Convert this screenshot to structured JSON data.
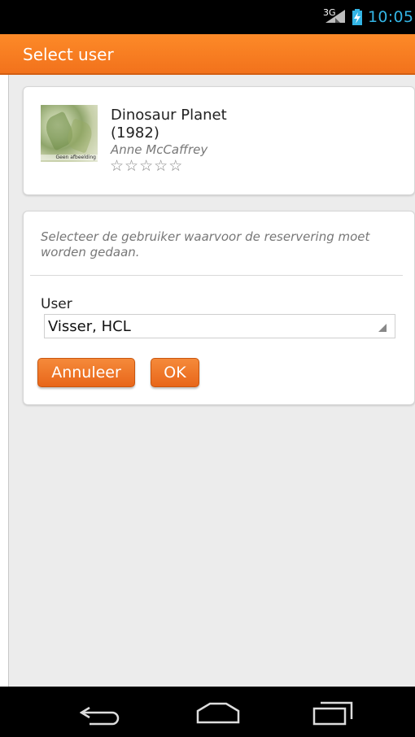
{
  "status_bar": {
    "network": "3G",
    "time": "10:05",
    "clock_color": "#33b5e5"
  },
  "action_bar": {
    "title": "Select user",
    "color": "#f57c20"
  },
  "book": {
    "title": "Dinosaur Planet (1982)",
    "author": "Anne McCaffrey",
    "cover_caption": "Geen afbeelding",
    "rating": 0,
    "max_rating": 5
  },
  "form": {
    "instructions": "Selecteer de gebruiker waarvoor de reservering moet worden gedaan.",
    "user_label": "User",
    "user_selected": "Visser, HCL",
    "cancel_label": "Annuleer",
    "ok_label": "OK"
  },
  "nav_bar": {
    "icons": [
      "back-icon",
      "home-icon",
      "recent-apps-icon"
    ]
  }
}
